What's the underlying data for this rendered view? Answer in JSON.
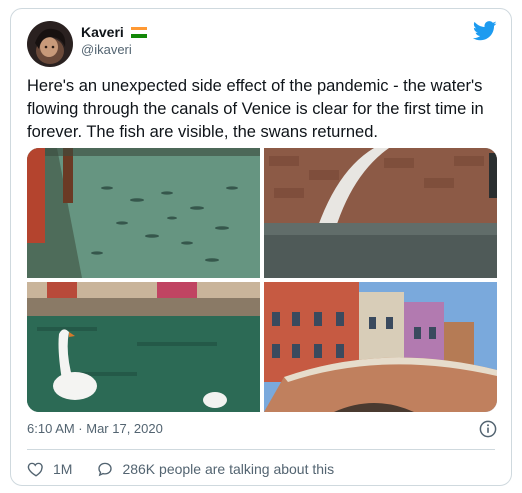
{
  "author": {
    "display_name": "Kaveri",
    "handle": "@ikaveri"
  },
  "tweet": {
    "text": "Here's an unexpected side effect of the pandemic - the water's flowing through the canals of Venice is clear for the first time in forever. The fish are visible, the swans returned.",
    "timestamp": "6:10 AM · Mar 17, 2020"
  },
  "media": [
    {
      "name": "fish-in-clear-canal-photo"
    },
    {
      "name": "stone-bridge-arch-photo"
    },
    {
      "name": "swan-in-canal-photo"
    },
    {
      "name": "venice-houses-bridge-photo"
    }
  ],
  "actions": {
    "likes": "1M",
    "conversation": "286K people are talking about this"
  },
  "colors": {
    "twitter_blue": "#1d9bf0",
    "like_red": "#f91880",
    "text_primary": "#0f1419",
    "text_secondary": "#536471",
    "border": "#cfd9de"
  },
  "icons": [
    "twitter-bird-icon",
    "india-flag-icon",
    "info-icon",
    "heart-icon",
    "comment-bubble-icon"
  ]
}
